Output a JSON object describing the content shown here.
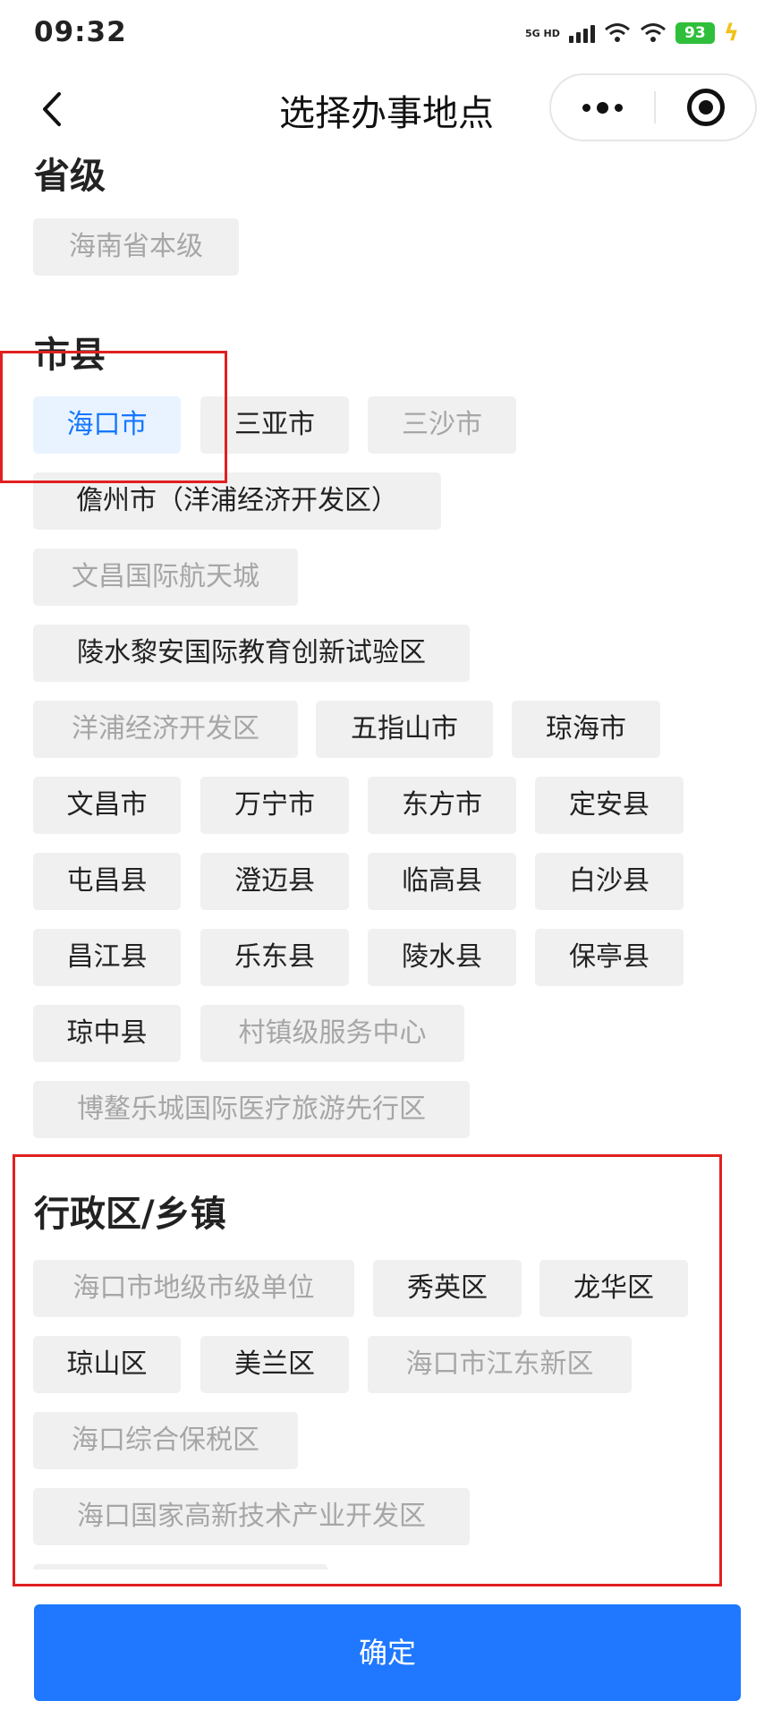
{
  "status": {
    "time": "09:32",
    "network": "5G HD",
    "battery": "93"
  },
  "nav": {
    "title": "选择办事地点"
  },
  "sections": {
    "province": {
      "title": "省级",
      "items": [
        "海南省本级"
      ]
    },
    "city": {
      "title": "市县",
      "items": [
        "海口市",
        "三亚市",
        "三沙市",
        "儋州市（洋浦经济开发区）",
        "文昌国际航天城",
        "陵水黎安国际教育创新试验区",
        "洋浦经济开发区",
        "五指山市",
        "琼海市",
        "文昌市",
        "万宁市",
        "东方市",
        "定安县",
        "屯昌县",
        "澄迈县",
        "临高县",
        "白沙县",
        "昌江县",
        "乐东县",
        "陵水县",
        "保亭县",
        "琼中县",
        "村镇级服务中心",
        "博鳌乐城国际医疗旅游先行区"
      ],
      "selected": "海口市"
    },
    "district": {
      "title": "行政区/乡镇",
      "items": [
        "海口市地级市级单位",
        "秀英区",
        "龙华区",
        "琼山区",
        "美兰区",
        "海口市江东新区",
        "海口综合保税区",
        "海口国家高新技术产业开发区"
      ]
    }
  },
  "confirm_label": "确定",
  "colors": {
    "accent": "#1f78ff",
    "selected_text": "#1677ff",
    "selected_bg": "#e9f3ff",
    "tag_bg": "#f0f0f0",
    "disabled_text": "#a6a6a6",
    "highlight": "#e02020"
  },
  "icons": {
    "back": "chevron-left-icon",
    "more": "more-dots-icon",
    "close": "target-icon"
  }
}
